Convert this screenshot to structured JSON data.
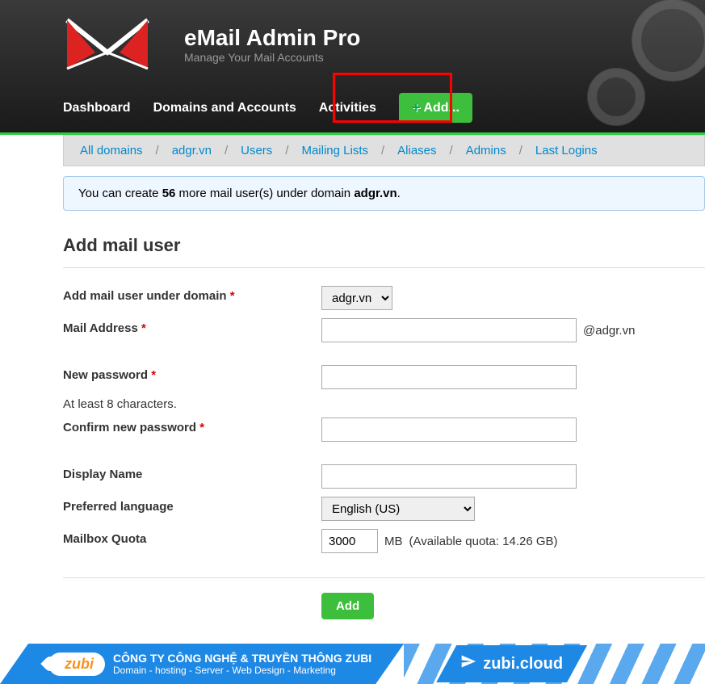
{
  "brand": {
    "title": "eMail Admin Pro",
    "subtitle": "Manage Your Mail Accounts"
  },
  "nav": {
    "dashboard": "Dashboard",
    "domains": "Domains and Accounts",
    "activities": "Activities",
    "add": "Add..."
  },
  "breadcrumb": [
    "All domains",
    "adgr.vn",
    "Users",
    "Mailing Lists",
    "Aliases",
    "Admins",
    "Last Logins"
  ],
  "notice": {
    "prefix": "You can create ",
    "count": "56",
    "mid": " more mail user(s) under domain ",
    "domain": "adgr.vn",
    "suffix": "."
  },
  "page_title": "Add mail user",
  "form": {
    "labels": {
      "domain": "Add mail user under domain",
      "mail_address": "Mail Address",
      "new_password": "New password",
      "pw_hint": "At least 8 characters.",
      "confirm_password": "Confirm new password",
      "display_name": "Display Name",
      "language": "Preferred language",
      "quota": "Mailbox Quota"
    },
    "domain_options": [
      "adgr.vn"
    ],
    "domain_selected": "adgr.vn",
    "mail_suffix": "@adgr.vn",
    "language_selected": "English (US)",
    "quota_value": "3000",
    "quota_unit": "MB",
    "quota_hint": "(Available quota: 14.26 GB)",
    "submit": "Add"
  },
  "footer": {
    "company": "CÔNG TY CÔNG NGHỆ & TRUYỀN THÔNG ZUBI",
    "tagline": "Domain - hosting - Server - Web Design - Marketing",
    "logo_text": "zubi",
    "cloud_text": "zubi.cloud"
  }
}
